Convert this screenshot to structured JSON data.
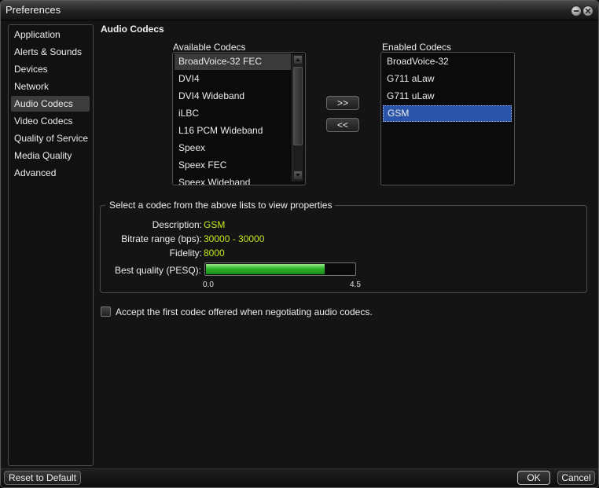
{
  "window": {
    "title": "Preferences"
  },
  "sidebar": {
    "items": [
      {
        "label": "Application"
      },
      {
        "label": "Alerts & Sounds"
      },
      {
        "label": "Devices"
      },
      {
        "label": "Network"
      },
      {
        "label": "Audio Codecs",
        "active": true
      },
      {
        "label": "Video Codecs"
      },
      {
        "label": "Quality of Service"
      },
      {
        "label": "Media Quality"
      },
      {
        "label": "Advanced"
      }
    ]
  },
  "main": {
    "title": "Audio Codecs",
    "available": {
      "caption": "Available Codecs",
      "items": [
        "BroadVoice-32 FEC",
        "DVI4",
        "DVI4 Wideband",
        "iLBC",
        "L16 PCM Wideband",
        "Speex",
        "Speex FEC",
        "Speex Wideband"
      ]
    },
    "enabled": {
      "caption": "Enabled Codecs",
      "items": [
        "BroadVoice-32",
        "G711 aLaw",
        "G711 uLaw",
        "GSM"
      ],
      "selected": "GSM"
    },
    "add_button": ">>",
    "remove_button": "<<",
    "properties": {
      "legend": "Select a codec from the above lists to view properties",
      "description_label": "Description:",
      "description_value": "GSM",
      "bitrate_label": "Bitrate range (bps):",
      "bitrate_value": "30000 - 30000",
      "fidelity_label": "Fidelity:",
      "fidelity_value": "8000",
      "quality_label": "Best quality (PESQ):",
      "quality_value": 3.6,
      "quality_min": "0.0",
      "quality_max": "4.5"
    },
    "accept_first": {
      "label": "Accept the first codec offered when negotiating audio codecs.",
      "checked": false
    }
  },
  "footer": {
    "reset_label": "Reset to Default",
    "ok_label": "OK",
    "cancel_label": "Cancel"
  },
  "colors": {
    "value_text": "#c5e81c",
    "selection": "#2a54a8",
    "progress": "#2fb52a"
  }
}
